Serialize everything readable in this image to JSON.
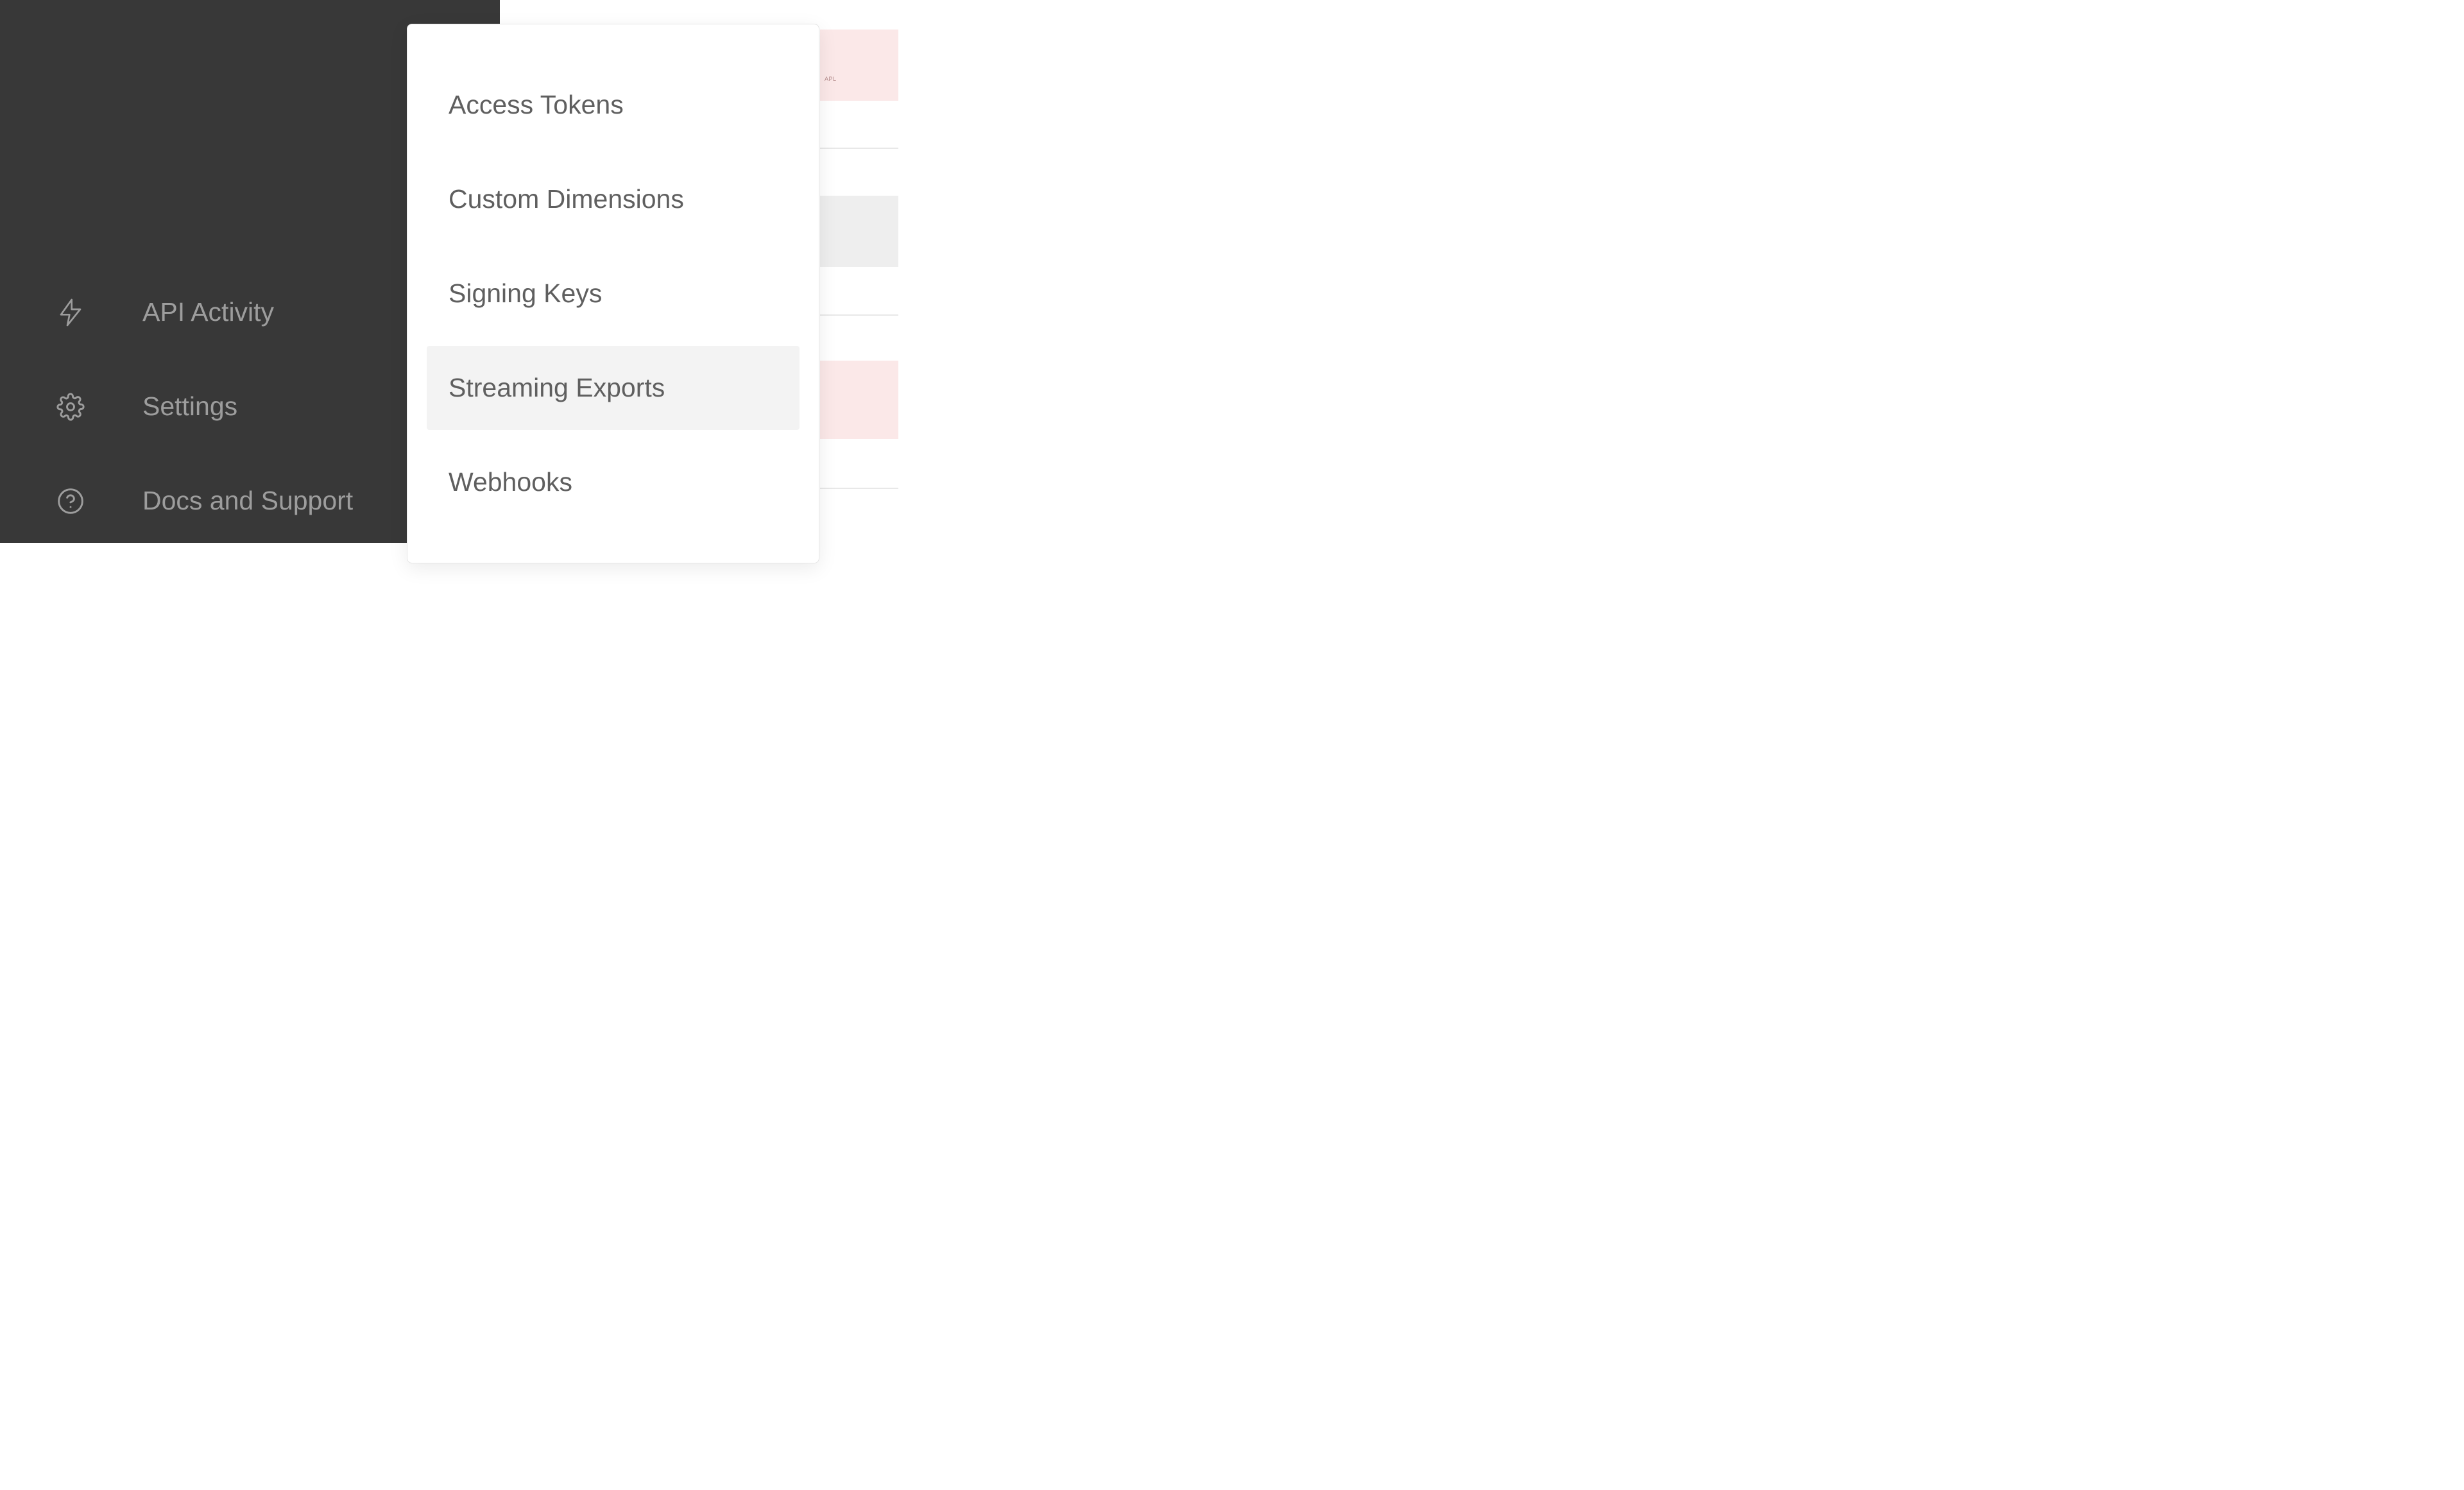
{
  "sidebar": {
    "items": [
      {
        "id": "api-activity",
        "label": "API Activity",
        "icon": "bolt"
      },
      {
        "id": "settings",
        "label": "Settings",
        "icon": "gear"
      },
      {
        "id": "docs-and-support",
        "label": "Docs and Support",
        "icon": "help"
      }
    ],
    "active": "settings"
  },
  "popover": {
    "items": [
      {
        "id": "access-tokens",
        "label": "Access Tokens"
      },
      {
        "id": "custom-dimensions",
        "label": "Custom Dimensions"
      },
      {
        "id": "signing-keys",
        "label": "Signing Keys"
      },
      {
        "id": "streaming-exports",
        "label": "Streaming Exports"
      },
      {
        "id": "webhooks",
        "label": "Webhooks"
      }
    ],
    "hovered": "streaming-exports"
  },
  "background": {
    "snippet": "APL"
  }
}
